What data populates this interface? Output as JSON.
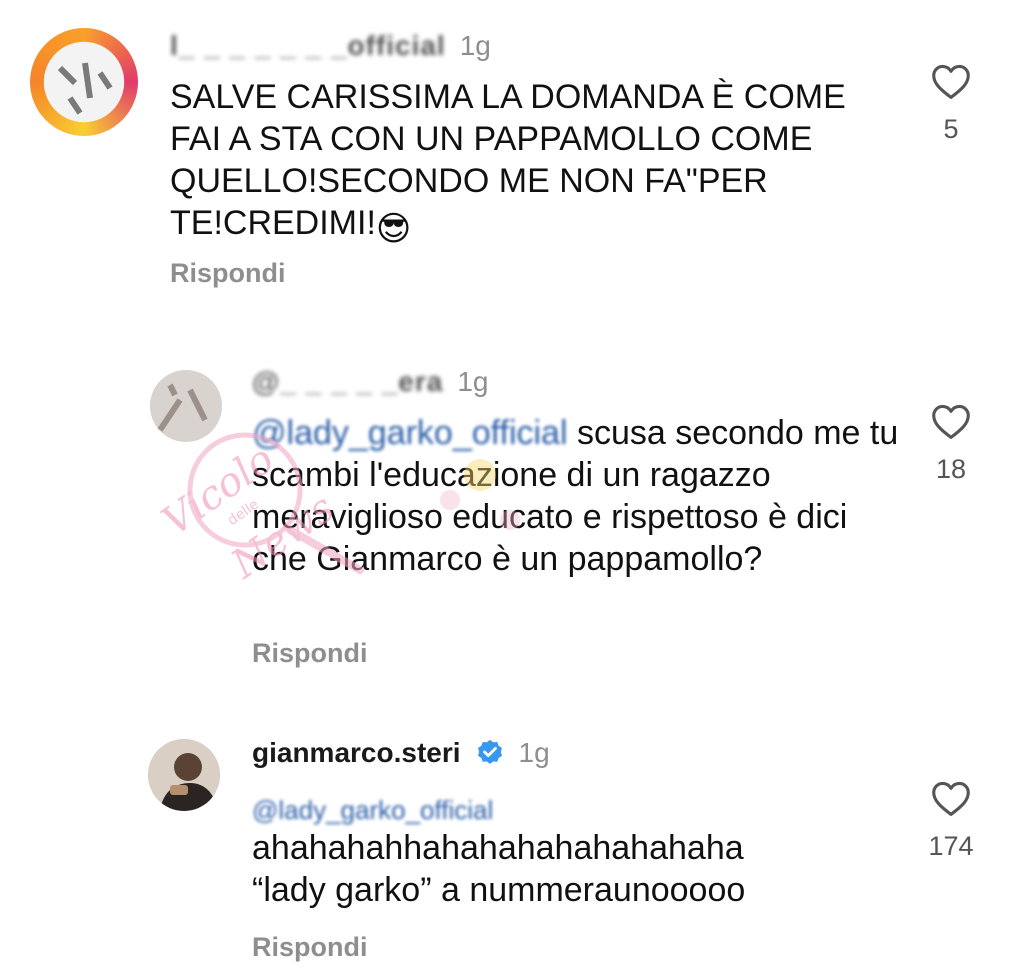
{
  "comments": [
    {
      "username": "l_ _ _ _ _ _ _official",
      "time": "1g",
      "text": "SALVE CARISSIMA LA DOMANDA È COME FAI A STA CON UN PAPPAMOLLO COME QUELLO!SECONDO ME NON FA\"PER TE!CREDIMI!",
      "emoji": "😎",
      "reply_label": "Rispondi",
      "likes": "5"
    },
    {
      "username": "@_ _ _ _ _era",
      "time": "1g",
      "mention": "@lady_garko_official",
      "text": "scusa secondo me  tu scambi l'educazione di un ragazzo meraviglioso educato e rispettoso è dici che Gianmarco è un pappamollo?",
      "reply_label": "Rispondi",
      "likes": "18"
    },
    {
      "username": "gianmarco.steri",
      "time": "1g",
      "mention": "@lady_garko_official",
      "text_line1": "ahahahahhahahahahahahahaha",
      "text_line2": "“lady garko” a nummeraunooooo",
      "reply_label": "Rispondi",
      "likes": "174"
    }
  ],
  "icons": {
    "like": "heart-outline-icon",
    "verified": "verified-badge-icon"
  },
  "watermark": {
    "word1": "Vicolo",
    "word2": "delle",
    "word3": "News"
  },
  "colors": {
    "text": "#111111",
    "meta": "#8e8e8e",
    "mention": "#2b5fa8",
    "verified": "#3897f0"
  }
}
